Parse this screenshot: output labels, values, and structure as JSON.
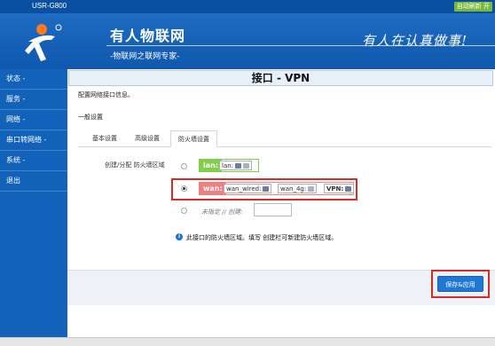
{
  "topbar": {
    "model": "USR-G800",
    "refresh_label": "自动刷新 开"
  },
  "header": {
    "title": "有人物联网",
    "subtitle": "-物联网之联网专家-",
    "slogan": "有人在认真做事!"
  },
  "sidebar": {
    "items": [
      {
        "label": "状态 -"
      },
      {
        "label": "服务 -"
      },
      {
        "label": "网络 -"
      },
      {
        "label": "串口转网络 -"
      },
      {
        "label": "系统 -"
      },
      {
        "label": "退出"
      }
    ]
  },
  "main": {
    "title": "接口 - VPN",
    "description": "配置网络接口信息。",
    "section": "一般设置",
    "tabs": [
      {
        "label": "基本设置"
      },
      {
        "label": "高级设置"
      },
      {
        "label": "防火墙设置"
      }
    ],
    "firewall_label": "创建/分配 防火墙区域",
    "zones": [
      {
        "name": "lan:",
        "color": "#7fcf4a",
        "networks": [
          "lan:"
        ]
      },
      {
        "name": "wan:",
        "color": "#f08080",
        "networks": [
          "wan_wired:",
          "wan_4g:",
          "VPN:"
        ]
      }
    ],
    "new_zone_label": "未指定 // 创建:",
    "info_text": "此接口的防火墙区域。填写 创建栏可新建防火墙区域。",
    "save_button": "保存&应用"
  }
}
